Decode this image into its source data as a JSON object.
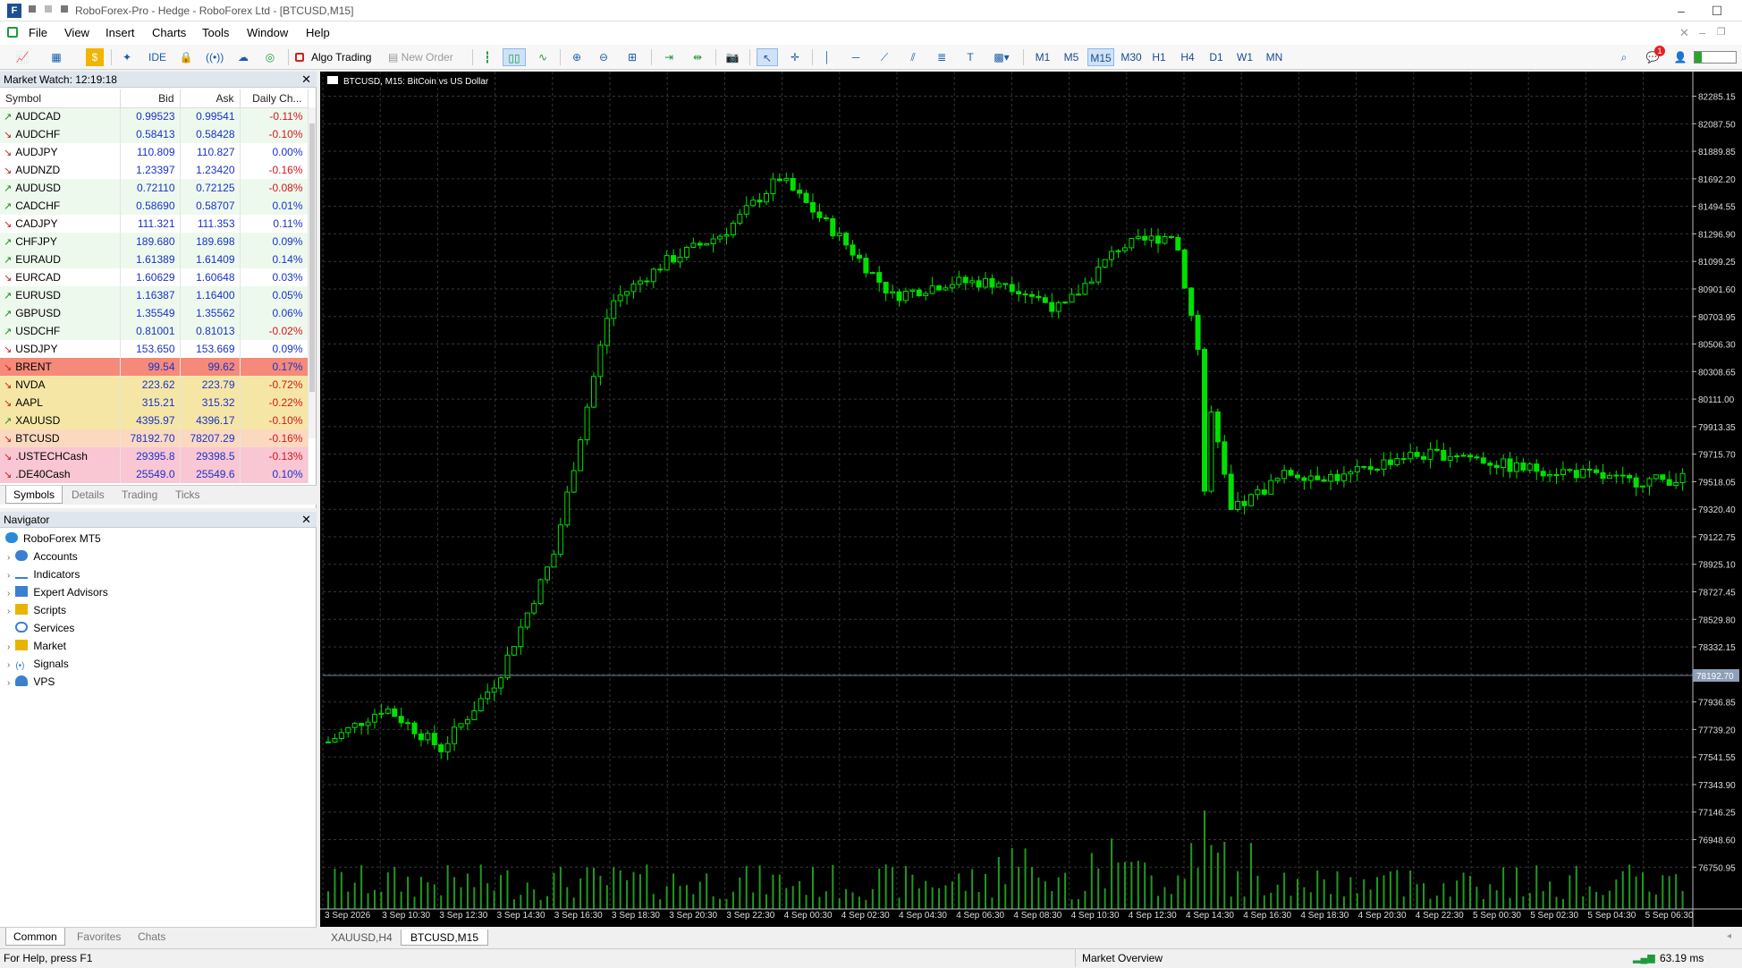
{
  "window": {
    "title": "RoboForex-Pro - Hedge - RoboForex Ltd - [BTCUSD,M15]"
  },
  "menu": [
    "File",
    "View",
    "Insert",
    "Charts",
    "Tools",
    "Window",
    "Help"
  ],
  "toolbar": {
    "ide": "IDE",
    "algo": "Algo Trading",
    "new_order": "New Order",
    "timeframes": [
      "M1",
      "M5",
      "M15",
      "M30",
      "H1",
      "H4",
      "D1",
      "W1",
      "MN"
    ],
    "active_timeframe": "M15",
    "notification_count": "1"
  },
  "market_watch": {
    "title": "Market Watch: 12:19:18",
    "columns": [
      "Symbol",
      "Bid",
      "Ask",
      "Daily Ch..."
    ],
    "rows": [
      {
        "s": "AUDCAD",
        "b": "0.99523",
        "a": "0.99541",
        "c": "-0.11%",
        "d": "up",
        "bg": "#eef9ee"
      },
      {
        "s": "AUDCHF",
        "b": "0.58413",
        "a": "0.58428",
        "c": "-0.10%",
        "d": "dn",
        "bg": "#eef9ee"
      },
      {
        "s": "AUDJPY",
        "b": "110.809",
        "a": "110.827",
        "c": "0.00%",
        "d": "dn",
        "bg": "#ffffff"
      },
      {
        "s": "AUDNZD",
        "b": "1.23397",
        "a": "1.23420",
        "c": "-0.16%",
        "d": "dn",
        "bg": "#ffffff"
      },
      {
        "s": "AUDUSD",
        "b": "0.72110",
        "a": "0.72125",
        "c": "-0.08%",
        "d": "up",
        "bg": "#eef9ee"
      },
      {
        "s": "CADCHF",
        "b": "0.58690",
        "a": "0.58707",
        "c": "0.01%",
        "d": "up",
        "bg": "#eef9ee"
      },
      {
        "s": "CADJPY",
        "b": "111.321",
        "a": "111.353",
        "c": "0.11%",
        "d": "dn",
        "bg": "#ffffff"
      },
      {
        "s": "CHFJPY",
        "b": "189.680",
        "a": "189.698",
        "c": "0.09%",
        "d": "up",
        "bg": "#eef9ee"
      },
      {
        "s": "EURAUD",
        "b": "1.61389",
        "a": "1.61409",
        "c": "0.14%",
        "d": "up",
        "bg": "#eef9ee"
      },
      {
        "s": "EURCAD",
        "b": "1.60629",
        "a": "1.60648",
        "c": "0.03%",
        "d": "dn",
        "bg": "#ffffff"
      },
      {
        "s": "EURUSD",
        "b": "1.16387",
        "a": "1.16400",
        "c": "0.05%",
        "d": "up",
        "bg": "#eef9ee"
      },
      {
        "s": "GBPUSD",
        "b": "1.35549",
        "a": "1.35562",
        "c": "0.06%",
        "d": "up",
        "bg": "#eef9ee"
      },
      {
        "s": "USDCHF",
        "b": "0.81001",
        "a": "0.81013",
        "c": "-0.02%",
        "d": "up",
        "bg": "#eef9ee"
      },
      {
        "s": "USDJPY",
        "b": "153.650",
        "a": "153.669",
        "c": "0.09%",
        "d": "dn",
        "bg": "#ffffff"
      },
      {
        "s": "BRENT",
        "b": "99.54",
        "a": "99.62",
        "c": "0.17%",
        "d": "dn",
        "bg": "#f58a7a"
      },
      {
        "s": "NVDA",
        "b": "223.62",
        "a": "223.79",
        "c": "-0.72%",
        "d": "dn",
        "bg": "#f6e6a6"
      },
      {
        "s": "AAPL",
        "b": "315.21",
        "a": "315.32",
        "c": "-0.22%",
        "d": "dn",
        "bg": "#f6e6a6"
      },
      {
        "s": "XAUUSD",
        "b": "4395.97",
        "a": "4396.17",
        "c": "-0.10%",
        "d": "up",
        "bg": "#f6e6a6"
      },
      {
        "s": "BTCUSD",
        "b": "78192.70",
        "a": "78207.29",
        "c": "-0.16%",
        "d": "dn",
        "bg": "#fbd9c0"
      },
      {
        "s": ".USTECHCash",
        "b": "29395.8",
        "a": "29398.5",
        "c": "-0.13%",
        "d": "dn",
        "bg": "#f9c6d4"
      },
      {
        "s": ".DE40Cash",
        "b": "25549.0",
        "a": "25549.6",
        "c": "0.10%",
        "d": "dn",
        "bg": "#f9c6d4"
      }
    ],
    "tabs": [
      "Symbols",
      "Details",
      "Trading",
      "Ticks"
    ]
  },
  "navigator": {
    "title": "Navigator",
    "root": "RoboForex MT5",
    "items": [
      "Accounts",
      "Indicators",
      "Expert Advisors",
      "Scripts",
      "Services",
      "Market",
      "Signals",
      "VPS"
    ],
    "tabs": [
      "Common",
      "Favorites",
      "Chats"
    ]
  },
  "chart": {
    "label": "BTCUSD, M15: BitCoin vs US Dollar",
    "price_label": "78192.70",
    "price_ticks": [
      "82285.15",
      "82087.50",
      "81889.85",
      "81692.20",
      "81494.55",
      "81296.90",
      "81099.25",
      "80901.60",
      "80703.95",
      "80506.30",
      "80308.65",
      "80111.00",
      "79913.35",
      "79715.70",
      "79518.05",
      "79320.40",
      "79122.75",
      "78925.10",
      "78727.45",
      "78529.80",
      "78332.15",
      "78134.50",
      "77936.85",
      "77739.20",
      "77541.55",
      "77343.90",
      "77146.25",
      "76948.60",
      "76750.95"
    ],
    "time_ticks": [
      "3 Sep 2026",
      "3 Sep 10:30",
      "3 Sep 12:30",
      "3 Sep 14:30",
      "3 Sep 16:30",
      "3 Sep 18:30",
      "3 Sep 20:30",
      "3 Sep 22:30",
      "4 Sep 00:30",
      "4 Sep 02:30",
      "4 Sep 04:30",
      "4 Sep 06:30",
      "4 Sep 08:30",
      "4 Sep 10:30",
      "4 Sep 12:30",
      "4 Sep 14:30",
      "4 Sep 16:30",
      "4 Sep 18:30",
      "4 Sep 20:30",
      "4 Sep 22:30",
      "5 Sep 00:30",
      "5 Sep 02:30",
      "5 Sep 04:30",
      "5 Sep 06:30"
    ],
    "tabs": [
      "XAUUSD,H4",
      "BTCUSD,M15"
    ],
    "active_tab": "BTCUSD,M15",
    "bull_color": "#00e000",
    "grid_color": "#2e3a2e"
  },
  "chart_data": {
    "type": "line",
    "title": "BTCUSD, M15: BitCoin vs US Dollar",
    "x": [
      "3 Sep 08:30",
      "3 Sep 10:30",
      "3 Sep 12:30",
      "3 Sep 14:30",
      "3 Sep 16:30",
      "3 Sep 18:30",
      "3 Sep 20:30",
      "3 Sep 22:30",
      "4 Sep 00:30",
      "4 Sep 02:30",
      "4 Sep 04:30",
      "4 Sep 06:30",
      "4 Sep 08:30",
      "4 Sep 10:30",
      "4 Sep 12:30",
      "4 Sep 14:30",
      "4 Sep 16:00",
      "4 Sep 18:30",
      "4 Sep 20:30",
      "4 Sep 22:30",
      "5 Sep 00:30",
      "5 Sep 02:30",
      "5 Sep 04:30",
      "5 Sep 06:30",
      "5 Sep 07:00"
    ],
    "series": [
      {
        "values": [
          77650,
          77900,
          77600,
          78100,
          79000,
          80800,
          81100,
          81300,
          81700,
          81300,
          80850,
          80950,
          80950,
          80750,
          81200,
          81300,
          79300,
          79580,
          79550,
          79700,
          79720,
          79620,
          79590,
          79520,
          79540
        ]
      }
    ],
    "ylim": [
      76650,
      82385
    ],
    "current_price": 78192.7
  },
  "status": {
    "help": "For Help, press F1",
    "overview": "Market Overview",
    "ping": "63.19 ms"
  }
}
